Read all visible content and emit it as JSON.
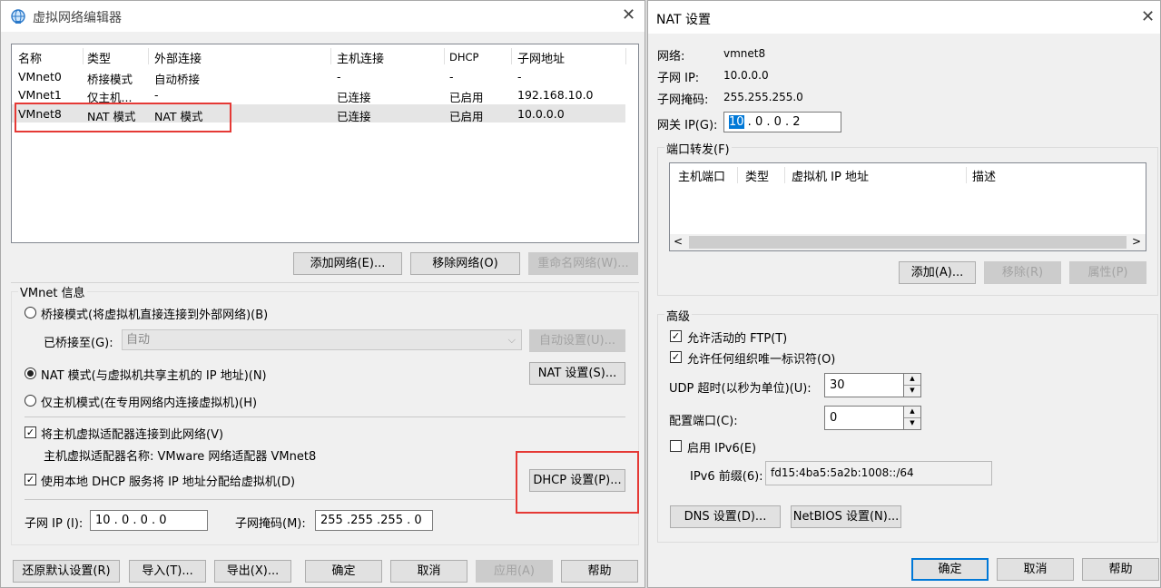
{
  "vne": {
    "title": "虚拟网络编辑器",
    "columns": [
      "名称",
      "类型",
      "外部连接",
      "主机连接",
      "DHCP",
      "子网地址"
    ],
    "rows": [
      [
        "VMnet0",
        "桥接模式",
        "自动桥接",
        "-",
        "-",
        "-"
      ],
      [
        "VMnet1",
        "仅主机...",
        "-",
        "已连接",
        "已启用",
        "192.168.10.0"
      ],
      [
        "VMnet8",
        "NAT 模式",
        "NAT 模式",
        "已连接",
        "已启用",
        "10.0.0.0"
      ]
    ],
    "add_network": "添加网络(E)...",
    "remove_network": "移除网络(O)",
    "rename_network": "重命名网络(W)...",
    "info_label": "VMnet 信息",
    "bridge_mode": "桥接模式(将虚拟机直接连接到外部网络)(B)",
    "bridged_to_label": "已桥接至(G):",
    "bridged_to_value": "自动",
    "auto_settings": "自动设置(U)...",
    "nat_mode": "NAT 模式(与虚拟机共享主机的 IP 地址)(N)",
    "nat_settings": "NAT 设置(S)...",
    "host_only": "仅主机模式(在专用网络内连接虚拟机)(H)",
    "connect_adapter": "将主机虚拟适配器连接到此网络(V)",
    "adapter_name": "主机虚拟适配器名称: VMware 网络适配器 VMnet8",
    "use_dhcp": "使用本地 DHCP 服务将 IP 地址分配给虚拟机(D)",
    "dhcp_settings": "DHCP 设置(P)...",
    "subnet_ip_label": "子网 IP (I):",
    "subnet_ip_value": "10 . 0 . 0 . 0",
    "subnet_mask_label": "子网掩码(M):",
    "subnet_mask_value": "255 .255 .255 . 0",
    "restore_defaults": "还原默认设置(R)",
    "import": "导入(T)...",
    "export": "导出(X)...",
    "ok": "确定",
    "cancel": "取消",
    "apply": "应用(A)",
    "help": "帮助"
  },
  "nat": {
    "title": "NAT 设置",
    "network_label": "网络:",
    "network_value": "vmnet8",
    "subnet_ip_label": "子网 IP:",
    "subnet_ip_value": "10.0.0.0",
    "subnet_mask_label": "子网掩码:",
    "subnet_mask_value": "255.255.255.0",
    "gateway_label": "网关 IP(G):",
    "gateway_first": "10",
    "gateway_rest": " .  0  .  0  .  2",
    "port_forward_label": "端口转发(F)",
    "pf_columns": [
      "主机端口",
      "类型",
      "虚拟机 IP 地址",
      "描述"
    ],
    "add": "添加(A)...",
    "remove": "移除(R)",
    "properties": "属性(P)",
    "advanced_label": "高级",
    "allow_ftp": "允许活动的 FTP(T)",
    "allow_oui": "允许任何组织唯一标识符(O)",
    "udp_timeout_label": "UDP 超时(以秒为单位)(U):",
    "udp_timeout_value": "30",
    "config_port_label": "配置端口(C):",
    "config_port_value": "0",
    "enable_ipv6": "启用 IPv6(E)",
    "ipv6_prefix_label": "IPv6 前缀(6):",
    "ipv6_prefix_value": "fd15:4ba5:5a2b:1008::/64",
    "dns_settings": "DNS 设置(D)...",
    "netbios_settings": "NetBIOS 设置(N)...",
    "ok": "确定",
    "cancel": "取消",
    "help": "帮助"
  },
  "colors": {
    "highlight": "#e53935",
    "focus": "#0078d7"
  },
  "icons": {
    "app": "network-globe-icon"
  }
}
